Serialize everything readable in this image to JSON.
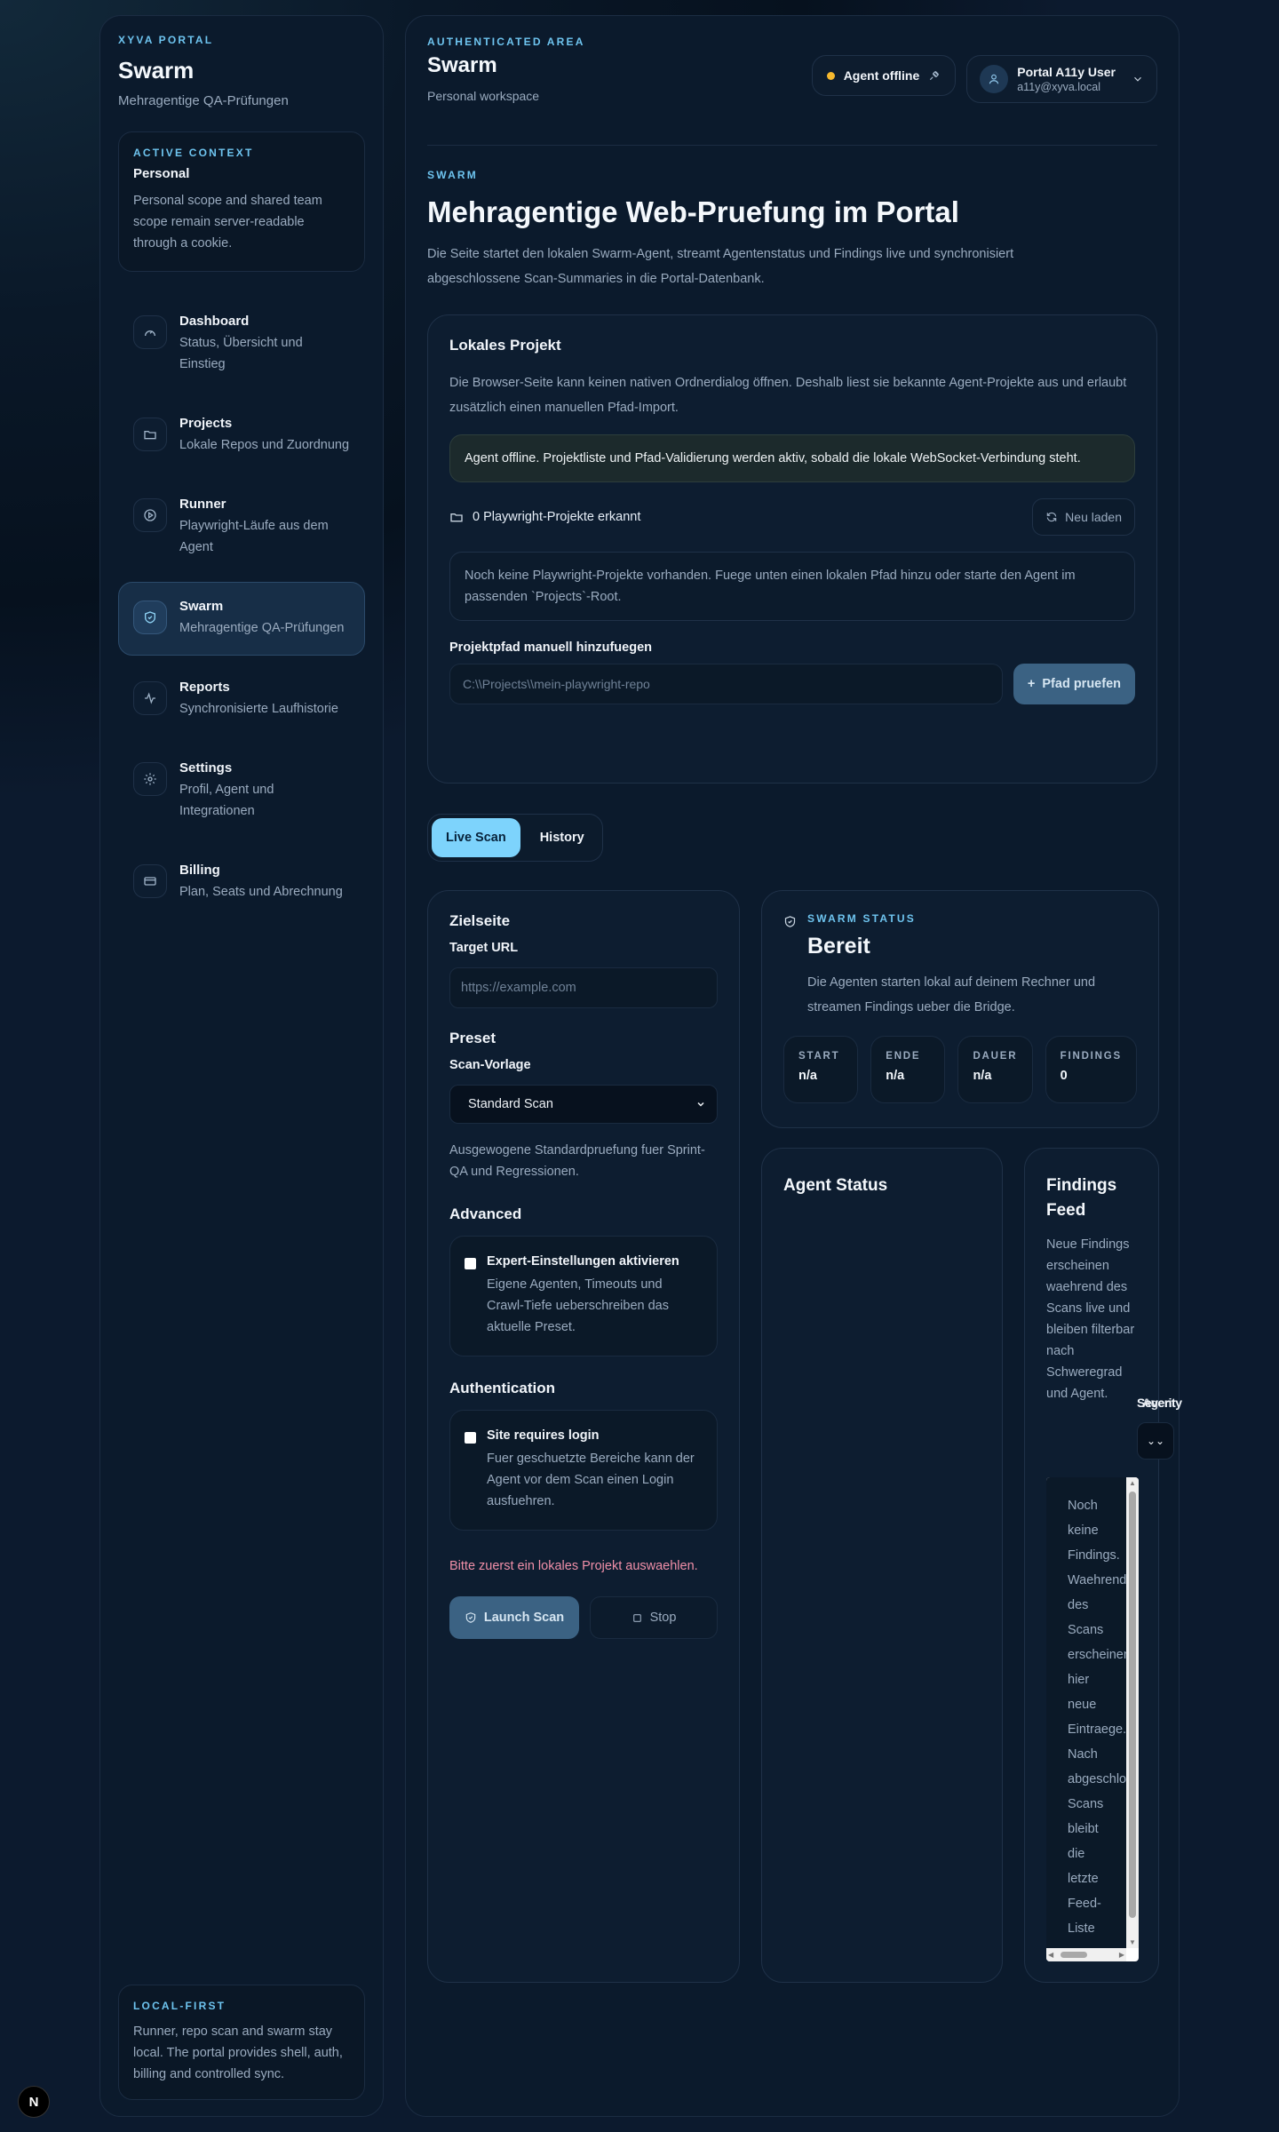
{
  "sidebar": {
    "eyebrow": "XYVA PORTAL",
    "title": "Swarm",
    "subtitle": "Mehragentige QA-Prüfungen",
    "context": {
      "eyebrow": "ACTIVE CONTEXT",
      "name": "Personal",
      "desc": "Personal scope and shared team scope remain server-readable through a cookie."
    },
    "items": [
      {
        "title": "Dashboard",
        "desc": "Status, Übersicht und Einstieg",
        "icon": "gauge-icon"
      },
      {
        "title": "Projects",
        "desc": "Lokale Repos und Zuordnung",
        "icon": "folder-icon"
      },
      {
        "title": "Runner",
        "desc": "Playwright-Läufe aus dem Agent",
        "icon": "play-circle-icon"
      },
      {
        "title": "Swarm",
        "desc": "Mehragentige QA-Prüfungen",
        "icon": "shield-icon"
      },
      {
        "title": "Reports",
        "desc": "Synchronisierte Laufhistorie",
        "icon": "activity-icon"
      },
      {
        "title": "Settings",
        "desc": "Profil, Agent und Integrationen",
        "icon": "gear-icon"
      },
      {
        "title": "Billing",
        "desc": "Plan, Seats und Abrechnung",
        "icon": "credit-card-icon"
      }
    ],
    "local_first": {
      "eyebrow": "LOCAL-FIRST",
      "desc": "Runner, repo scan and swarm stay local. The portal provides shell, auth, billing and controlled sync."
    }
  },
  "next_badge": "N",
  "header": {
    "eyebrow": "AUTHENTICATED AREA",
    "title": "Swarm",
    "subtitle": "Personal workspace",
    "agent_status": "Agent offline",
    "user_name": "Portal A11y User",
    "user_email": "a11y@xyva.local"
  },
  "page": {
    "eyebrow": "SWARM",
    "title": "Mehragentige Web-Pruefung im Portal",
    "intro": "Die Seite startet den lokalen Swarm-Agent, streamt Agentenstatus und Findings live und synchronisiert abgeschlossene Scan-Summaries in die Portal-Datenbank."
  },
  "project": {
    "title": "Lokales Projekt",
    "desc": "Die Browser-Seite kann keinen nativen Ordnerdialog öffnen. Deshalb liest sie bekannte Agent-Projekte aus und erlaubt zusätzlich einen manuellen Pfad-Import.",
    "offline_notice": "Agent offline. Projektliste und Pfad-Validierung werden aktiv, sobald die lokale WebSocket-Verbindung steht.",
    "count_text": "0 Playwright-Projekte erkannt",
    "reload_label": "Neu laden",
    "empty_text": "Noch keine Playwright-Projekte vorhanden. Fuege unten einen lokalen Pfad hinzu oder starte den Agent im passenden `Projects`-Root.",
    "path_label": "Projektpfad manuell hinzufuegen",
    "path_placeholder": "C:\\\\Projects\\\\mein-playwright-repo",
    "check_label": "Pfad pruefen"
  },
  "tabs": [
    "Live Scan",
    "History"
  ],
  "form": {
    "target_heading": "Zielseite",
    "target_label": "Target URL",
    "target_placeholder": "https://example.com",
    "preset_heading": "Preset",
    "preset_label": "Scan-Vorlage",
    "preset_value": "Standard Scan",
    "preset_help": "Ausgewogene Standardpruefung fuer Sprint-QA und Regressionen.",
    "advanced_heading": "Advanced",
    "advanced_title": "Expert-Einstellungen aktivieren",
    "advanced_desc": "Eigene Agenten, Timeouts und Crawl-Tiefe ueberschreiben das aktuelle Preset.",
    "auth_heading": "Authentication",
    "auth_title": "Site requires login",
    "auth_desc": "Fuer geschuetzte Bereiche kann der Agent vor dem Scan einen Login ausfuehren.",
    "error": "Bitte zuerst ein lokales Projekt auswaehlen.",
    "launch_label": "Launch Scan",
    "stop_label": "Stop"
  },
  "status": {
    "eyebrow": "SWARM STATUS",
    "title": "Bereit",
    "desc": "Die Agenten starten lokal auf deinem Rechner und streamen Findings ueber die Bridge.",
    "stats": [
      {
        "label": "START",
        "value": "n/a"
      },
      {
        "label": "ENDE",
        "value": "n/a"
      },
      {
        "label": "DAUER",
        "value": "n/a"
      },
      {
        "label": "FINDINGS",
        "value": "0"
      }
    ]
  },
  "agent": {
    "title": "Agent Status"
  },
  "findings": {
    "title": "Findings Feed",
    "desc": "Neue Findings erscheinen waehrend des Scans live und bleiben filterbar nach Schweregrad und Agent.",
    "filter_label": "Severity",
    "filter_label_overlap": "Agent",
    "empty_lines": [
      "Noch",
      "keine",
      "Findings.",
      "Waehrend",
      "des",
      "Scans",
      "erscheinen",
      "hier",
      "neue",
      "Eintraege.",
      "Nach",
      "abgeschlossenen",
      "Scans",
      "bleibt",
      "die",
      "letzte",
      "Feed-",
      "Liste"
    ]
  }
}
